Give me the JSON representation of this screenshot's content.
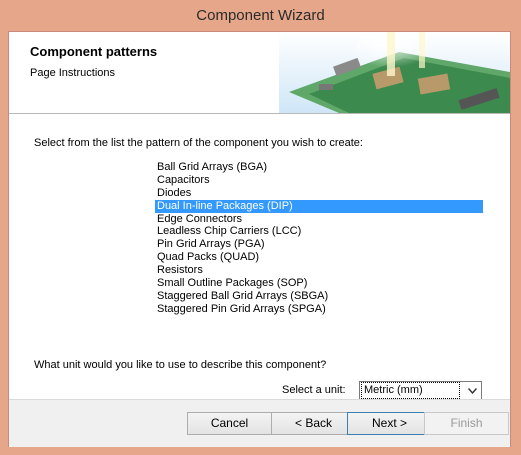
{
  "window": {
    "title": "Component Wizard"
  },
  "header": {
    "title": "Component patterns",
    "subtitle": "Page Instructions"
  },
  "body": {
    "prompt": "Select from the list the pattern of the component you wish to create:",
    "patterns": [
      "Ball Grid Arrays (BGA)",
      "Capacitors",
      "Diodes",
      "Dual In-line Packages (DIP)",
      "Edge Connectors",
      "Leadless Chip Carriers (LCC)",
      "Pin Grid Arrays (PGA)",
      "Quad Packs (QUAD)",
      "Resistors",
      "Small Outline Packages (SOP)",
      "Staggered Ball Grid Arrays (SBGA)",
      "Staggered Pin Grid Arrays (SPGA)"
    ],
    "selected_pattern": "Dual In-line Packages (DIP)",
    "unit_question": "What unit would you like to use to describe this component?",
    "unit_label": "Select a unit:",
    "unit_value": "Metric (mm)"
  },
  "buttons": {
    "cancel": "Cancel",
    "back": "< Back",
    "next": "Next >",
    "finish": "Finish"
  },
  "colors": {
    "window_frame": "#e5a68a",
    "selection": "#3399ff"
  }
}
